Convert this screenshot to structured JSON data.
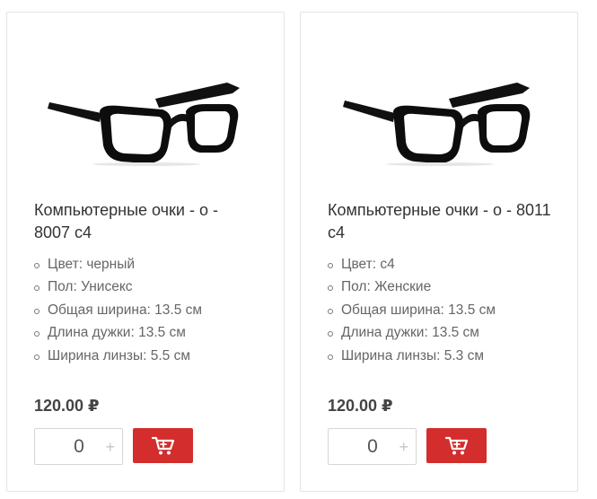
{
  "products": [
    {
      "title": "Компьютерные очки - о - 8007 с4",
      "specs": [
        "Цвет: черный",
        "Пол: Унисекс",
        "Общая ширина: 13.5 см",
        "Длина дужки: 13.5 см",
        "Ширина линзы: 5.5 см"
      ],
      "price": "120.00 ₽",
      "quantity": "0",
      "plus": "+"
    },
    {
      "title": "Компьютерные очки - о - 8011 с4",
      "specs": [
        "Цвет: с4",
        "Пол: Женские",
        "Общая ширина: 13.5 см",
        "Длина дужки: 13.5 см",
        "Ширина линзы: 5.3 см"
      ],
      "price": "120.00 ₽",
      "quantity": "0",
      "plus": "+"
    }
  ],
  "colors": {
    "accent": "#d32d2d",
    "border": "#e3e3e3",
    "text": "#333333",
    "muted": "#666666"
  },
  "icons": {
    "cart": "shopping-cart-icon",
    "plus": "plus-icon"
  }
}
